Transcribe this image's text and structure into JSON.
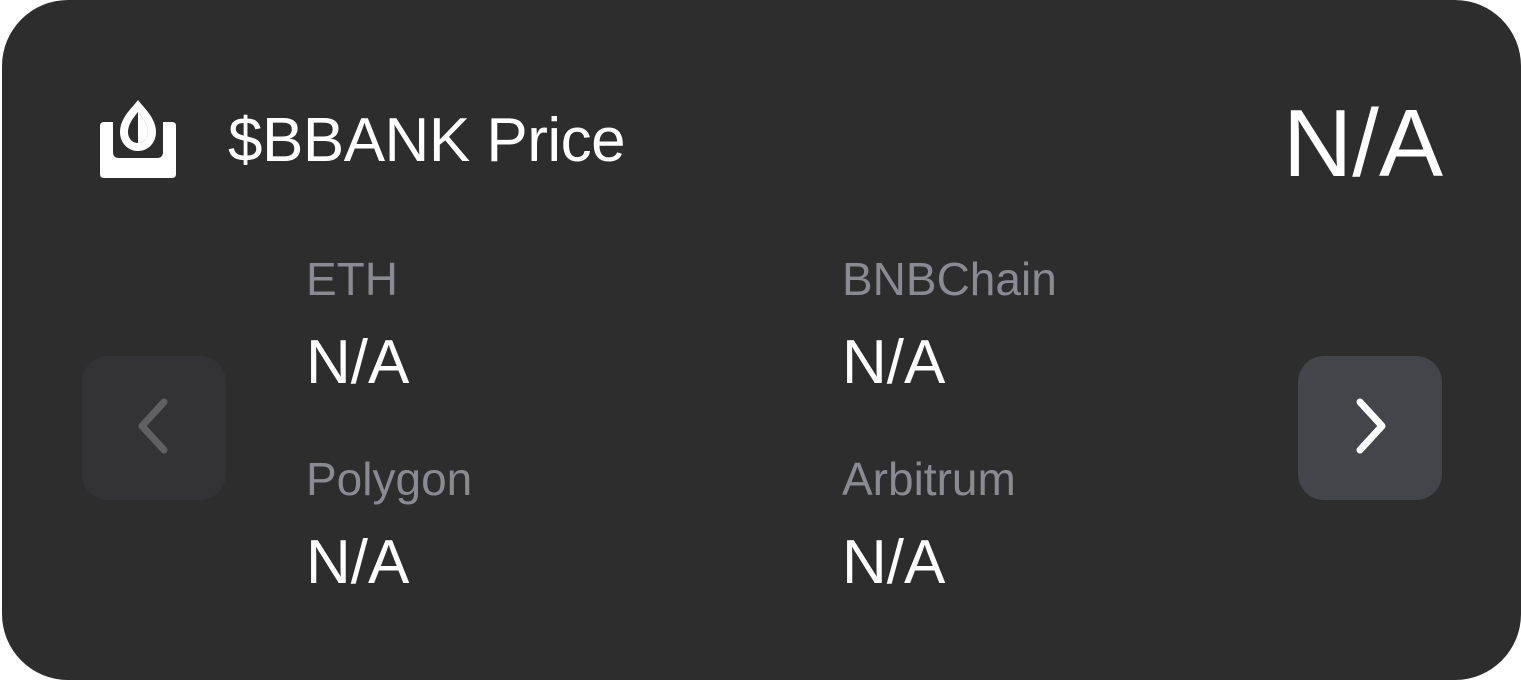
{
  "card": {
    "title": "$BBANK Price",
    "price": "N/A"
  },
  "chains": [
    {
      "label": "ETH",
      "value": "N/A"
    },
    {
      "label": "BNBChain",
      "value": "N/A"
    },
    {
      "label": "Polygon",
      "value": "N/A"
    },
    {
      "label": "Arbitrum",
      "value": "N/A"
    }
  ],
  "icons": {
    "logo": "bbank-logo-icon",
    "prev": "chevron-left-icon",
    "next": "chevron-right-icon"
  },
  "colors": {
    "card_background": "#2d2d2d",
    "text_primary": "#ffffff",
    "text_muted": "#8a8a92",
    "prev_button_bg": "#333336",
    "next_button_bg": "#43454b"
  }
}
